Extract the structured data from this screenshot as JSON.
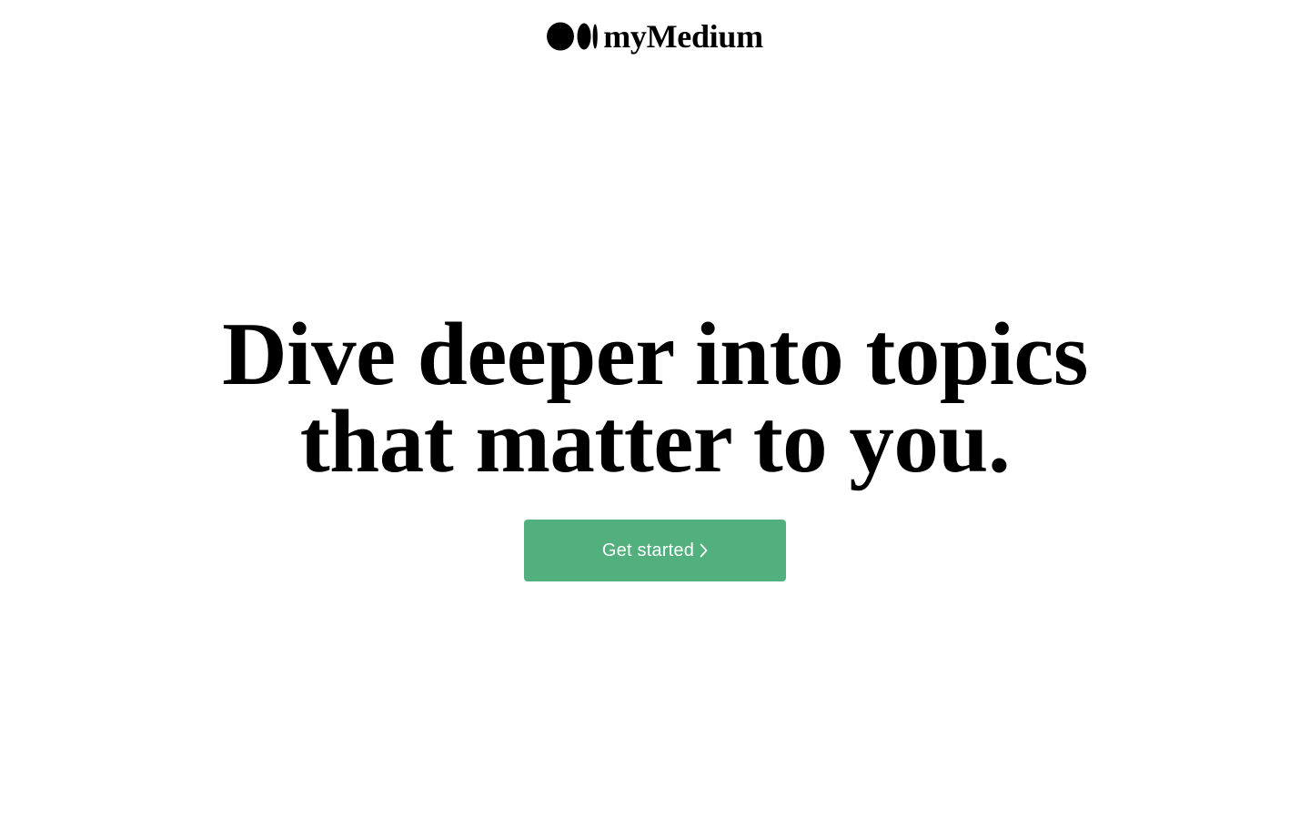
{
  "header": {
    "brand_name": "myMedium",
    "logo_icon": "medium-logo-icon"
  },
  "hero": {
    "title_line_1": "Dive deeper into topics",
    "title_line_2": "that matter to you.",
    "cta_label": "Get started",
    "cta_icon": "chevron-right-icon"
  },
  "colors": {
    "background": "#ffffff",
    "text": "#000000",
    "cta_background": "#52b07e",
    "cta_text": "#ffffff"
  }
}
